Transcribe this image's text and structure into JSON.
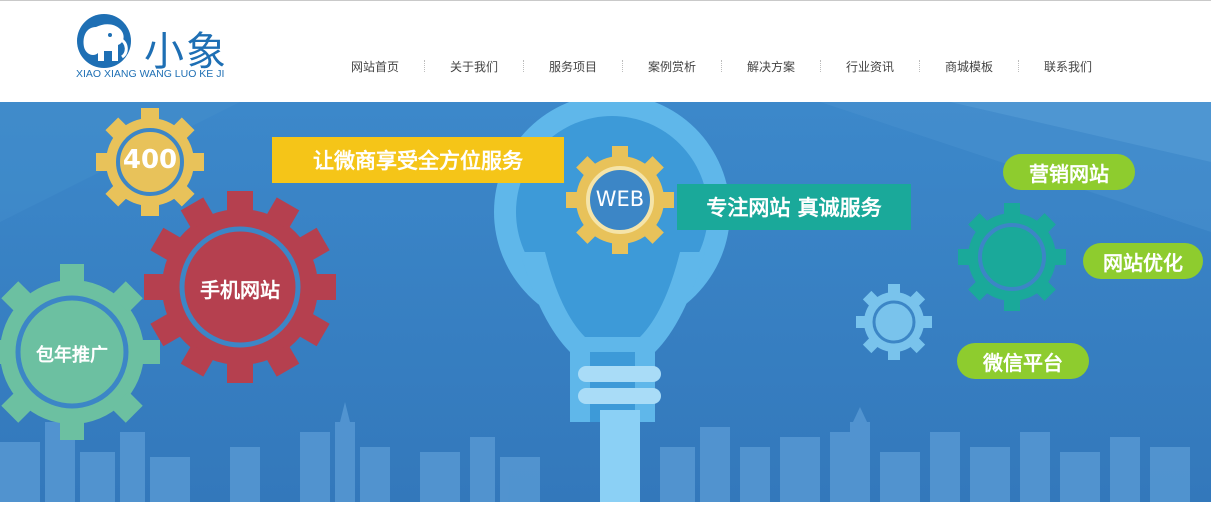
{
  "logo": {
    "title": "小象",
    "subtitle": "XIAO XIANG WANG LUO KE JI",
    "icon": "elephant-logo-icon"
  },
  "nav": {
    "items": [
      {
        "label": "网站首页"
      },
      {
        "label": "关于我们"
      },
      {
        "label": "服务项目"
      },
      {
        "label": "案例赏析"
      },
      {
        "label": "解决方案"
      },
      {
        "label": "行业资讯"
      },
      {
        "label": "商城模板"
      },
      {
        "label": "联系我们"
      }
    ]
  },
  "banner": {
    "slogan_yellow": "让微商享受全方位服务",
    "slogan_teal": "专注网站 真诚服务",
    "web_label": "WEB",
    "gear_400": "400",
    "gear_mobile": "手机网站",
    "gear_promo": "包年推广",
    "pill_marketing": "营销网站",
    "pill_seo": "网站优化",
    "pill_wechat": "微信平台"
  },
  "colors": {
    "brand": "#1e6fb4",
    "banner_bg": "#3b86c8",
    "yellow_gear": "#e8c25a",
    "red_gear": "#b5404f",
    "green_gear": "#6cc0a1",
    "teal": "#1aa99a",
    "pill_green": "#8ecc2e",
    "slogan_yellow": "#f5c518"
  }
}
